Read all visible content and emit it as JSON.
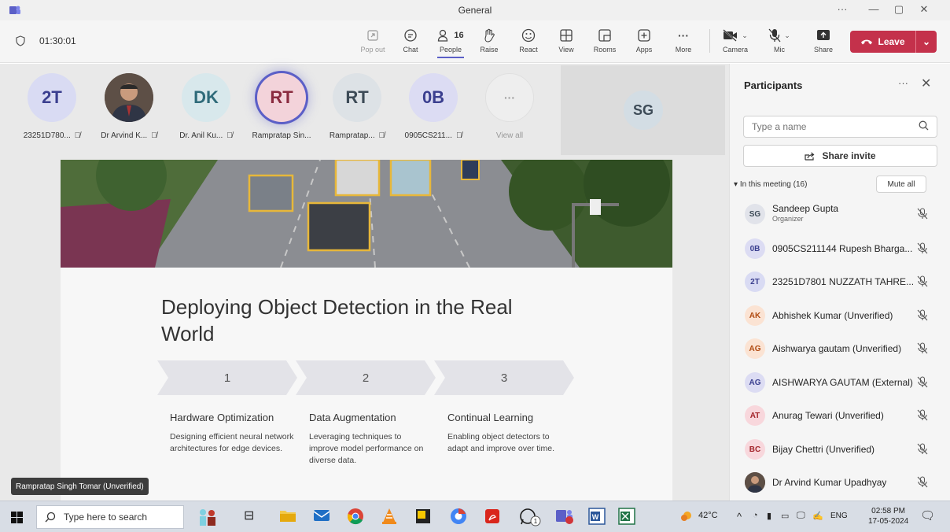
{
  "window": {
    "title": "General"
  },
  "toolbar": {
    "timer": "01:30:01",
    "popout": "Pop out",
    "chat": "Chat",
    "people": "People",
    "people_count": "16",
    "raise": "Raise",
    "react": "React",
    "view": "View",
    "rooms": "Rooms",
    "apps": "Apps",
    "more": "More",
    "camera": "Camera",
    "mic": "Mic",
    "share": "Share",
    "leave": "Leave"
  },
  "stage": {
    "participants": [
      {
        "initials": "2T",
        "name": "23251D780...",
        "color": "#d9dbf3",
        "text_color": "#3b3f8f"
      },
      {
        "initials": "",
        "name": "Dr Arvind K...",
        "photo": true
      },
      {
        "initials": "DK",
        "name": "Dr. Anil Ku...",
        "color": "#d8e8ec",
        "text_color": "#2f6b7a"
      },
      {
        "initials": "RT",
        "name": "Rampratap Sin...",
        "color": "#f3d3da",
        "text_color": "#8a2b3f",
        "active": true
      },
      {
        "initials": "RT",
        "name": "Rampratap...",
        "color": "#dde2e6",
        "text_color": "#3d4b57"
      },
      {
        "initials": "0B",
        "name": "0905CS211...",
        "color": "#dcdcf3",
        "text_color": "#3b3f8f"
      },
      {
        "initials": "···",
        "name": "View all",
        "color": "#eeeeee",
        "text_color": "#999999"
      }
    ],
    "sg_tile": {
      "initials": "SG"
    },
    "name_tag": "Rampratap Singh Tomar (Unverified)"
  },
  "slide": {
    "title": "Deploying Object Detection in the Real World",
    "steps": [
      {
        "num": "1",
        "heading": "Hardware Optimization",
        "body": "Designing efficient neural network architectures for edge devices."
      },
      {
        "num": "2",
        "heading": "Data Augmentation",
        "body": "Leveraging techniques to improve model performance on diverse data."
      },
      {
        "num": "3",
        "heading": "Continual Learning",
        "body": "Enabling object detectors to adapt and improve over time."
      }
    ]
  },
  "panel": {
    "title": "Participants",
    "search_placeholder": "Type a name",
    "share_invite": "Share invite",
    "in_meeting": "In this meeting (16)",
    "mute_all": "Mute all",
    "people": [
      {
        "initials": "SG",
        "name": "Sandeep Gupta",
        "role": "Organizer",
        "color": "#e1e3ea",
        "text_color": "#3d4b57"
      },
      {
        "initials": "0B",
        "name": "0905CS211144 Rupesh Bharga...",
        "color": "#dcdcf3",
        "text_color": "#3b3f8f"
      },
      {
        "initials": "2T",
        "name": "23251D7801 NUZZATH TAHRE...",
        "color": "#d9dbf3",
        "text_color": "#3b3f8f"
      },
      {
        "initials": "AK",
        "name": "Abhishek Kumar (Unverified)",
        "color": "#fbe3d3",
        "text_color": "#b04a11"
      },
      {
        "initials": "AG",
        "name": "Aishwarya gautam (Unverified)",
        "color": "#fbe3d3",
        "text_color": "#b04a11"
      },
      {
        "initials": "AG",
        "name": "AISHWARYA GAUTAM (External)",
        "color": "#dcdcf3",
        "text_color": "#3b3f8f"
      },
      {
        "initials": "AT",
        "name": "Anurag Tewari (Unverified)",
        "color": "#f8d7dc",
        "text_color": "#a4262c"
      },
      {
        "initials": "BC",
        "name": "Bijay Chettri (Unverified)",
        "color": "#f8d7dc",
        "text_color": "#a4262c"
      },
      {
        "initials": "",
        "name": "Dr Arvind Kumar Upadhyay",
        "photo": true
      }
    ]
  },
  "taskbar": {
    "search_placeholder": "Type here to search",
    "weather": "42°C",
    "lang": "ENG",
    "time": "02:58 PM",
    "date": "17-05-2024"
  },
  "colors": {
    "accent": "#5b5fc7",
    "leave": "#c4314b"
  }
}
